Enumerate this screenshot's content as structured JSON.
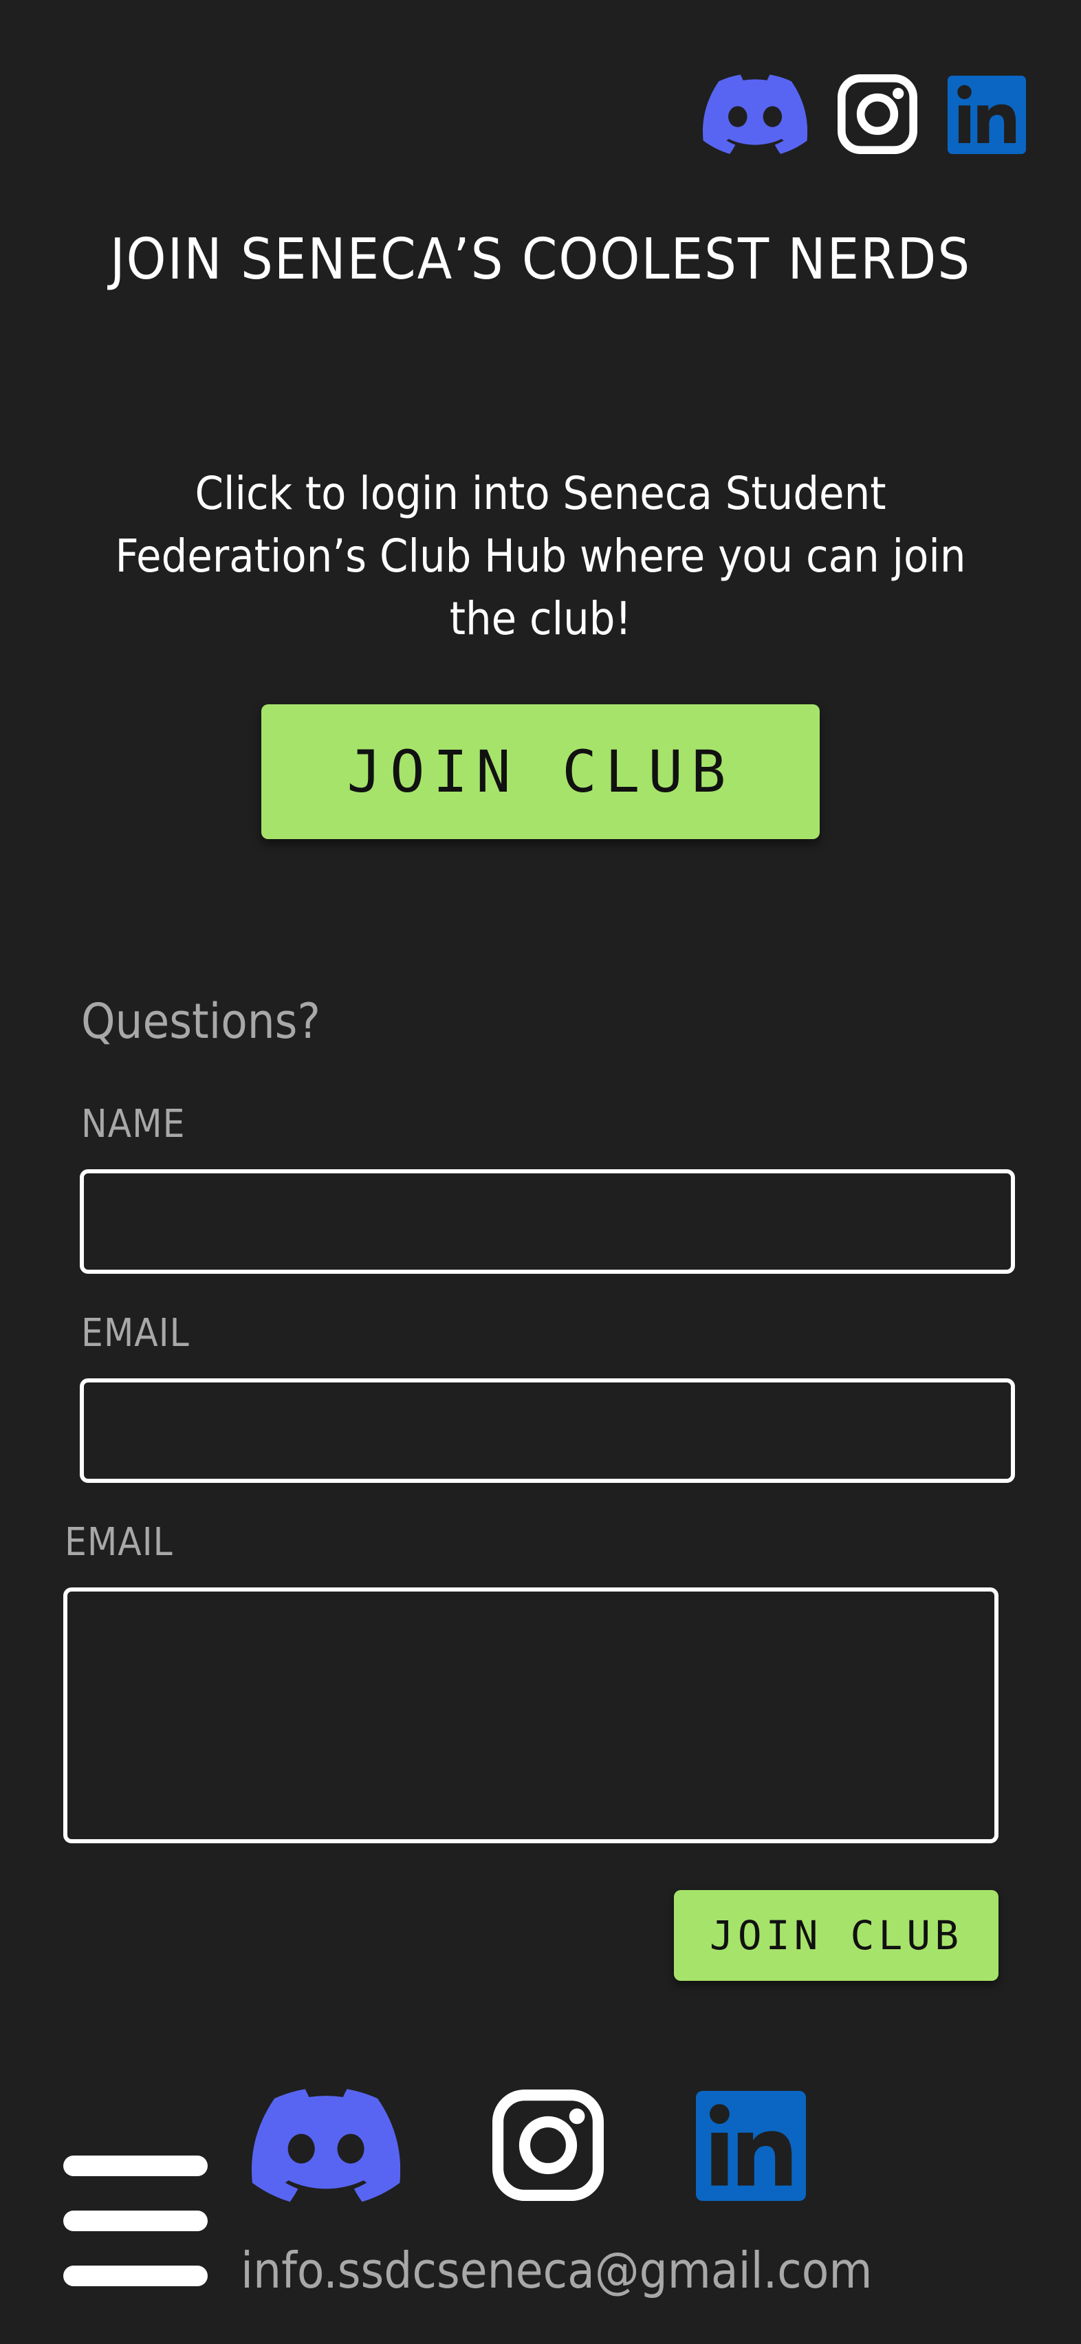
{
  "header": {
    "icons": [
      "discord-icon",
      "instagram-icon",
      "linkedin-icon"
    ]
  },
  "hero": {
    "title": "JOIN SENECA’S COOLEST NERDS",
    "intro": "Click to login into Seneca Student Federation’s Club Hub where you can join the club!",
    "join_button_label": "JOIN CLUB"
  },
  "contact_form": {
    "heading": "Questions?",
    "name_label": "NAME",
    "name_value": "",
    "email_label": "EMAIL",
    "email_value": "",
    "message_label": "EMAIL",
    "message_value": "",
    "submit_label": "JOIN CLUB"
  },
  "footer": {
    "icons": [
      "menu-icon",
      "discord-icon",
      "instagram-icon",
      "linkedin-icon"
    ],
    "email": "info.ssdcseneca@gmail.com"
  },
  "colors": {
    "background": "#1f1f1f",
    "accent": "#a6e36a",
    "discord": "#5865f2",
    "linkedin": "#0a66c2",
    "muted_text": "#a8a8a8"
  }
}
